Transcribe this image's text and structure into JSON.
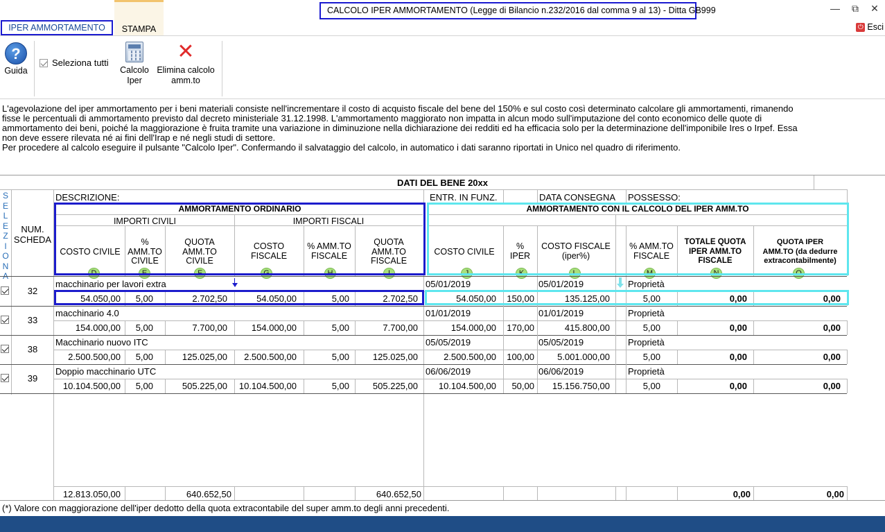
{
  "window": {
    "title": "CALCOLO IPER AMMORTAMENTO (Legge di Bilancio n.232/2016 dal comma 9 al 13) - Ditta GB999",
    "minimize": "—",
    "restore": "⧉",
    "close": "✕"
  },
  "tabs": {
    "iper": "IPER AMMORTAMENTO",
    "stampa": "STAMPA",
    "esci": "Esci"
  },
  "ribbon": {
    "guida": "Guida",
    "seleziona_tutti": "Seleziona tutti",
    "calcolo_line1": "Calcolo",
    "calcolo_line2": "Iper",
    "elimina_line1": "Elimina calcolo",
    "elimina_line2": "amm.to"
  },
  "description": {
    "line1": "L'agevolazione del iper ammortamento per i beni materiali consiste nell'incrementare il costo di acquisto fiscale del bene del 150% e sul costo così determinato calcolare gli ammortamenti, rimanendo",
    "line2": "fisse le percentuali di ammortamento previsto dal decreto ministeriale 31.12.1998. L'ammortamento maggiorato non impatta in alcun modo sull'imputazione del conto economico delle quote di",
    "line3": "ammortamento dei beni, poiché la maggiorazione è fruita tramite una variazione in diminuzione nella dichiarazione dei redditi ed ha efficacia solo per la determinazione dell'imponibile Ires o Irpef. Essa",
    "line4": "non deve essere rilevata né ai fini dell'Irap e né negli studi di settore.",
    "line5": "Per procedere al calcolo eseguire il pulsante \"Calcolo Iper\". Confermando il salvataggio del calcolo, in automatico i dati saranno riportati in Unico nel quadro di riferimento."
  },
  "grid": {
    "section_title": "DATI DEL BENE 20xx",
    "seleziona_vertical": "SELEZIONA",
    "num_scheda_1": "NUM.",
    "num_scheda_2": "SCHEDA",
    "descrizione": "DESCRIZIONE:",
    "entr_funz": "ENTR. IN FUNZ.",
    "data_consegna": "DATA CONSEGNA",
    "possesso": "POSSESSO:",
    "amm_ordinario": "AMMORTAMENTO ORDINARIO",
    "amm_iper": "AMMORTAMENTO CON IL CALCOLO DEL IPER AMM.TO",
    "importi_civili": "IMPORTI CIVILI",
    "importi_fiscali": "IMPORTI FISCALI",
    "col_D": "COSTO CIVILE",
    "col_E_1": "%",
    "col_E_2": "AMM.TO",
    "col_E_3": "CIVILE",
    "col_F_1": "QUOTA",
    "col_F_2": "AMM.TO",
    "col_F_3": "CIVILE",
    "col_G_1": "COSTO",
    "col_G_2": "FISCALE",
    "col_H_1": "% AMM.TO",
    "col_H_2": "FISCALE",
    "col_I_1": "QUOTA",
    "col_I_2": "AMM.TO",
    "col_I_3": "FISCALE",
    "col_J": "COSTO CIVILE",
    "col_K_1": "%",
    "col_K_2": "IPER",
    "col_L_1": "COSTO FISCALE",
    "col_L_2": "(iper%)",
    "col_M_1": "% AMM.TO",
    "col_M_2": "FISCALE",
    "col_N_1": "TOTALE QUOTA",
    "col_N_2": "IPER AMM.TO",
    "col_N_3": "FISCALE",
    "col_O_1": "QUOTA IPER",
    "col_O_2": "AMM.TO (da dedurre",
    "col_O_3": "extracontabilmente)",
    "letters": [
      "D",
      "E",
      "F",
      "G",
      "H",
      "I",
      "J",
      "K",
      "L",
      "M",
      "N",
      "O"
    ],
    "rows": [
      {
        "scheda": "32",
        "descrizione": "macchinario per lavori extra",
        "entr": "05/01/2019",
        "consegna": "05/01/2019",
        "possesso": "Proprietà",
        "costo_civile": "54.050,00",
        "perc_civ": "5,00",
        "quota_civ": "2.702,50",
        "costo_fisc": "54.050,00",
        "perc_fisc": "5,00",
        "quota_fisc": "2.702,50",
        "costo_civile_iper": "54.050,00",
        "perc_iper": "150,00",
        "costo_fisc_iper": "135.125,00",
        "perc_amm_iper": "5,00",
        "tot_quota": "0,00",
        "quota_iper": "0,00"
      },
      {
        "scheda": "33",
        "descrizione": "macchinario 4.0",
        "entr": "01/01/2019",
        "consegna": "01/01/2019",
        "possesso": "Proprietà",
        "costo_civile": "154.000,00",
        "perc_civ": "5,00",
        "quota_civ": "7.700,00",
        "costo_fisc": "154.000,00",
        "perc_fisc": "5,00",
        "quota_fisc": "7.700,00",
        "costo_civile_iper": "154.000,00",
        "perc_iper": "170,00",
        "costo_fisc_iper": "415.800,00",
        "perc_amm_iper": "5,00",
        "tot_quota": "0,00",
        "quota_iper": "0,00"
      },
      {
        "scheda": "38",
        "descrizione": "Macchinario nuovo ITC",
        "entr": "05/05/2019",
        "consegna": "05/05/2019",
        "possesso": "Proprietà",
        "costo_civile": "2.500.500,00",
        "perc_civ": "5,00",
        "quota_civ": "125.025,00",
        "costo_fisc": "2.500.500,00",
        "perc_fisc": "5,00",
        "quota_fisc": "125.025,00",
        "costo_civile_iper": "2.500.500,00",
        "perc_iper": "100,00",
        "costo_fisc_iper": "5.001.000,00",
        "perc_amm_iper": "5,00",
        "tot_quota": "0,00",
        "quota_iper": "0,00"
      },
      {
        "scheda": "39",
        "descrizione": "Doppio macchinario UTC",
        "entr": "06/06/2019",
        "consegna": "06/06/2019",
        "possesso": "Proprietà",
        "costo_civile": "10.104.500,00",
        "perc_civ": "5,00",
        "quota_civ": "505.225,00",
        "costo_fisc": "10.104.500,00",
        "perc_fisc": "5,00",
        "quota_fisc": "505.225,00",
        "costo_civile_iper": "10.104.500,00",
        "perc_iper": "50,00",
        "costo_fisc_iper": "15.156.750,00",
        "perc_amm_iper": "5,00",
        "tot_quota": "0,00",
        "quota_iper": "0,00"
      }
    ],
    "totals": {
      "costo_civile": "12.813.050,00",
      "quota_civ": "640.652,50",
      "quota_fisc": "640.652,50",
      "tot_quota": "0,00",
      "quota_iper": "0,00"
    }
  },
  "footnote": "(*) Valore con maggiorazione dell'iper dedotto della quota extracontabile del super amm.to degli anni precedenti."
}
